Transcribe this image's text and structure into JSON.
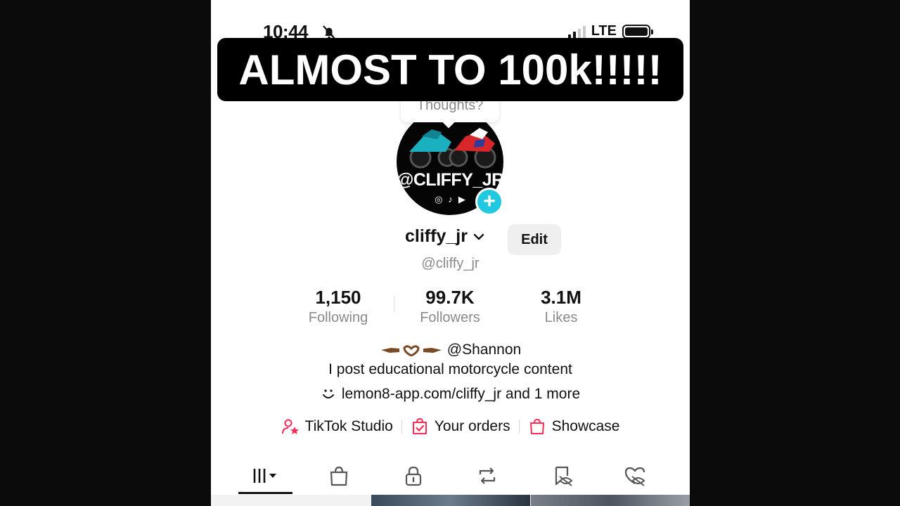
{
  "status_bar": {
    "time": "10:44",
    "network": "LTE"
  },
  "caption": "ALMOST TO 100k!!!!!",
  "prompt_bubble": "Thoughts?",
  "avatar": {
    "text": "@CLIFFY_JR",
    "socials": [
      "instagram-icon",
      "tiktok-icon",
      "youtube-icon"
    ]
  },
  "profile": {
    "display_name": "cliffy_jr",
    "edit_label": "Edit",
    "handle": "@cliffy_jr"
  },
  "stats": [
    {
      "value": "1,150",
      "label": "Following"
    },
    {
      "value": "99.7K",
      "label": "Followers"
    },
    {
      "value": "3.1M",
      "label": "Likes"
    }
  ],
  "bio": {
    "mention": "@Shannon",
    "text": "I post educational motorcycle content",
    "link": "lemon8-app.com/cliffy_jr and 1 more"
  },
  "shortcuts": [
    {
      "label": "TikTok Studio",
      "icon": "creator-star-icon"
    },
    {
      "label": "Your orders",
      "icon": "order-check-icon"
    },
    {
      "label": "Showcase",
      "icon": "shopping-bag-icon"
    }
  ],
  "tabs": [
    "videos-grid-icon",
    "shop-bag-icon",
    "lock-icon",
    "repost-icon",
    "favorites-eye-icon",
    "liked-heart-icon"
  ],
  "colors": {
    "accent": "#22c8e0",
    "brand_pink": "#fe2c55",
    "caption_bg": "#000000"
  }
}
